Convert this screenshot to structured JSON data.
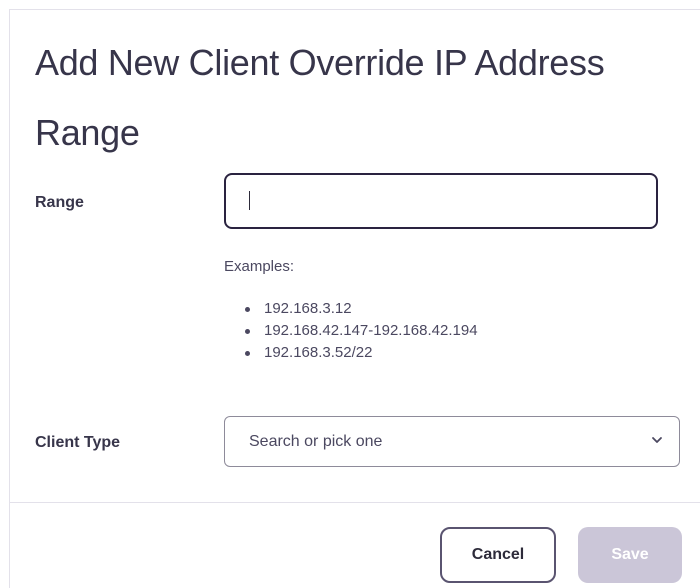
{
  "dialog": {
    "title": "Add New Client Override IP Address Range"
  },
  "range": {
    "label": "Range",
    "value": "",
    "examples_title": "Examples:",
    "examples": [
      "192.168.3.12",
      "192.168.42.147-192.168.42.194",
      "192.168.3.52/22"
    ]
  },
  "client_type": {
    "label": "Client Type",
    "placeholder": "Search or pick one"
  },
  "footer": {
    "cancel_label": "Cancel",
    "save_label": "Save"
  },
  "colors": {
    "focus_border": "#2a2340",
    "save_disabled": "#cbc6d8"
  },
  "icons": {
    "select_toggle": "chevron-down-icon"
  }
}
